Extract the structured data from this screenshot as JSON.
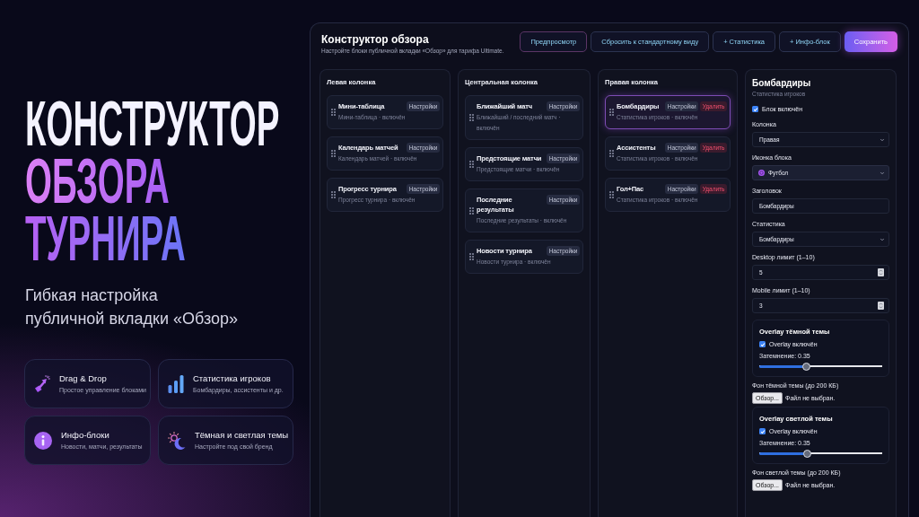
{
  "hero": {
    "title_lines": [
      {
        "kind": "plain",
        "text": "КОНСТРУКТОР"
      },
      {
        "kind": "violet",
        "text": "ОБЗОРА"
      },
      {
        "kind": "violet-blue",
        "text": "ТУРНИРА"
      }
    ],
    "subtitle_lines": [
      "Гибкая настройка",
      "публичной вкладки «Обзор»"
    ],
    "features": [
      {
        "kind": "drag-drop",
        "title": "Drag & Drop",
        "description": "Простое управление блоками"
      },
      {
        "kind": "stats",
        "title": "Статистика игроков",
        "description": "Бомбардиры, ассистенты и др."
      },
      {
        "kind": "info",
        "title": "Инфо-блоки",
        "description": "Новости, матчи, результаты"
      },
      {
        "kind": "theme",
        "title": "Тёмная и светлая темы",
        "description": "Настройте под свой бренд"
      }
    ]
  },
  "editor": {
    "title": "Конструктор обзора",
    "subtitle": "Настройте блоки публичной вкладки «Обзор» для тарифа Ultimate.",
    "buttons": [
      {
        "kind": "accent-outline",
        "label": "Предпросмотр"
      },
      {
        "kind": "outline",
        "label": "Сбросить к стандартному виду"
      },
      {
        "kind": "outline",
        "label": "+ Статистика"
      },
      {
        "kind": "outline",
        "label": "+ Инфо-блок"
      },
      {
        "kind": "primary",
        "label": "Сохранить"
      }
    ],
    "columns": [
      {
        "title": "Левая колонка",
        "blocks": [
          {
            "title": "Мини-таблица",
            "description": "Мини-таблица · включён",
            "settings_label": "Настройки",
            "selected": false
          },
          {
            "title": "Календарь матчей",
            "description": "Календарь матчей · включён",
            "settings_label": "Настройки",
            "selected": false
          },
          {
            "title": "Прогресс турнира",
            "description": "Прогресс турнира · включён",
            "settings_label": "Настройки",
            "selected": false
          }
        ]
      },
      {
        "title": "Центральная колонка",
        "blocks": [
          {
            "title": "Ближайший матч",
            "description": "Ближайший / последний матч · включён",
            "settings_label": "Настройки",
            "selected": false
          },
          {
            "title": "Предстоящие матчи",
            "description": "Предстоящие матчи · включён",
            "settings_label": "Настройки",
            "selected": false
          },
          {
            "title": "Последние результаты",
            "description": "Последние результаты · включён",
            "settings_label": "Настройки",
            "selected": false
          },
          {
            "title": "Новости турнира",
            "description": "Новости турнира · включён",
            "settings_label": "Настройки",
            "selected": false
          }
        ]
      },
      {
        "title": "Правая колонка",
        "blocks": [
          {
            "title": "Бомбардиры",
            "description": "Статистика игроков · включён",
            "settings_label": "Настройки",
            "delete_label": "Удалить",
            "selected": true
          },
          {
            "title": "Ассистенты",
            "description": "Статистика игроков · включён",
            "settings_label": "Настройки",
            "delete_label": "Удалить",
            "selected": false
          },
          {
            "title": "Гол+Пас",
            "description": "Статистика игроков · включён",
            "settings_label": "Настройки",
            "delete_label": "Удалить",
            "selected": false
          }
        ]
      }
    ],
    "settings": {
      "title": "Бомбардиры",
      "subtitle": "Статистика игроков",
      "enabled": {
        "label": "Блок включён",
        "checked": true
      },
      "fields": [
        {
          "kind": "select",
          "label": "Колонка",
          "value": "Правая"
        },
        {
          "kind": "icon-select",
          "label": "Иконка блока",
          "value": "Футбол"
        },
        {
          "kind": "text",
          "label": "Заголовок",
          "value": "Бомбардиры"
        },
        {
          "kind": "select",
          "label": "Статистика",
          "value": "Бомбардиры"
        },
        {
          "kind": "number",
          "label": "Desktop лимит (1–10)",
          "value": "5"
        },
        {
          "kind": "number",
          "label": "Mobile лимит (1–10)",
          "value": "3"
        }
      ],
      "overlays": [
        {
          "title": "Overlay тёмной темы",
          "toggle": {
            "label": "Overlay включён",
            "checked": true
          },
          "dimming_label": "Затемнение: 0.35",
          "level": 0.38,
          "background": {
            "label": "Фон тёмной темы (до 200 КБ)",
            "button": "Обзор...",
            "status": "Файл не выбран."
          }
        },
        {
          "title": "Overlay светлой темы",
          "toggle": {
            "label": "Overlay включён",
            "checked": true
          },
          "dimming_label": "Затемнение: 0.35",
          "level": 0.39,
          "background": {
            "label": "Фон светлой темы (до 200 КБ)",
            "button": "Обзор...",
            "status": "Файл не выбран."
          }
        }
      ]
    }
  }
}
